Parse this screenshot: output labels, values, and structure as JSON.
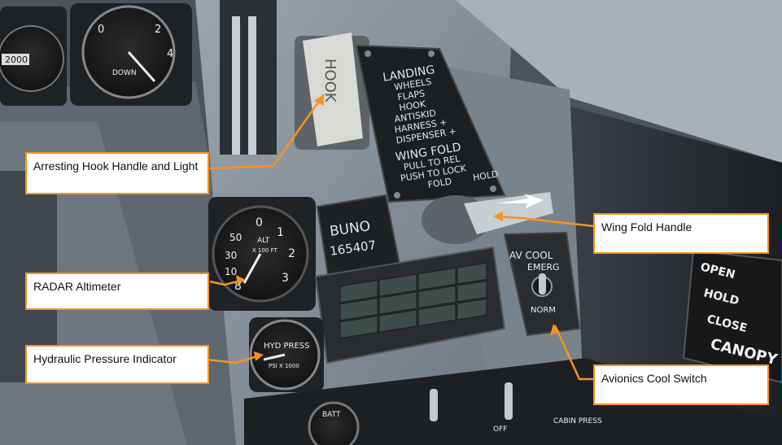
{
  "callouts": {
    "hook": "Arresting Hook Handle and Light",
    "wing_fold": "Wing Fold Handle",
    "radar_alt": "RADAR Altimeter",
    "hyd_press": "Hydraulic Pressure Indicator",
    "av_cool": "Avionics Cool Switch"
  },
  "panel": {
    "hook_label": "HOOK",
    "placard_lines": [
      "LANDING",
      "WHEELS",
      "FLAPS",
      "HOOK",
      "ANTISKID",
      "HARNESS +",
      "DISPENSER +",
      "WING FOLD",
      "PULL TO REL",
      "PUSH TO LOCK",
      "FOLD",
      "HOLD"
    ],
    "buno_title": "BUNO",
    "buno_number": "165407",
    "av_cool_title": "AV COOL",
    "av_cool_emerg": "EMERG",
    "av_cool_norm": "NORM",
    "canopy_lines": [
      "OPEN",
      "HOLD",
      "CLOSE",
      "CANOPY"
    ],
    "radalt_label": "ALT",
    "radalt_units": "X 100 FT",
    "hyd_label": "HYD PRESS",
    "hyd_units": "PSI X 1000",
    "batt_label": "BATT",
    "cabin_label": "CABIN PRESS",
    "off_label": "OFF",
    "norm_label": "NORM"
  },
  "colors": {
    "accent": "#f7931e",
    "panel": "#8a949e"
  }
}
